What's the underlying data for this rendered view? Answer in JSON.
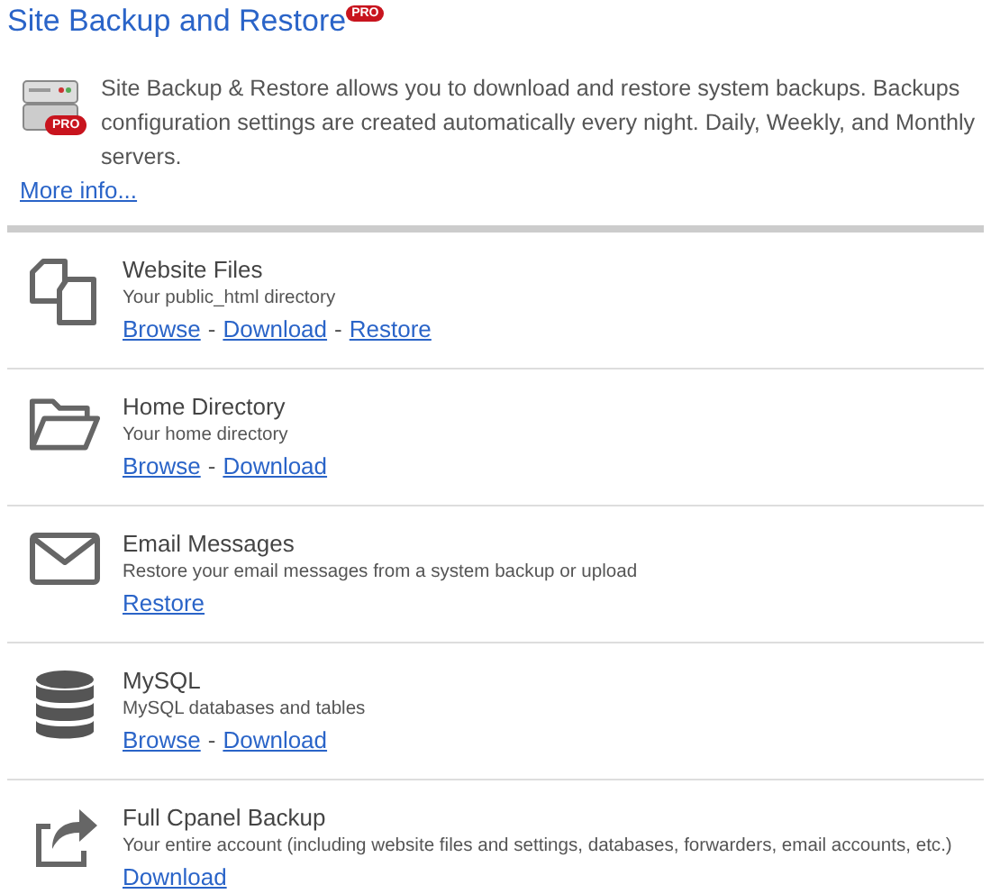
{
  "title": "Site Backup and Restore",
  "title_badge": "PRO",
  "intro": {
    "icon_badge": "PRO",
    "text": "Site Backup & Restore allows you to download and restore system backups. Backups\nconfiguration settings are created automatically every night. Daily, Weekly, and Monthly\nservers.",
    "link": "More info..."
  },
  "items": [
    {
      "kind": "files",
      "title": "Website Files",
      "description": "Your public_html directory",
      "links": [
        {
          "kind": "link",
          "text": "Browse"
        },
        {
          "kind": "separator",
          "text": "-"
        },
        {
          "kind": "link",
          "text": "Download"
        },
        {
          "kind": "separator",
          "text": "-"
        },
        {
          "kind": "link",
          "text": "Restore"
        }
      ]
    },
    {
      "kind": "folder",
      "title": "Home Directory",
      "description": "Your home directory",
      "links": [
        {
          "kind": "link",
          "text": "Browse"
        },
        {
          "kind": "separator",
          "text": "-"
        },
        {
          "kind": "link",
          "text": "Download"
        }
      ]
    },
    {
      "kind": "mail",
      "title": "Email Messages",
      "description": "Restore your email messages from a system backup or upload",
      "links": [
        {
          "kind": "link",
          "text": "Restore"
        }
      ]
    },
    {
      "kind": "database",
      "title": "MySQL",
      "description": "MySQL databases and tables",
      "links": [
        {
          "kind": "link",
          "text": "Browse"
        },
        {
          "kind": "separator",
          "text": "-"
        },
        {
          "kind": "link",
          "text": "Download"
        }
      ]
    },
    {
      "kind": "share",
      "title": "Full Cpanel Backup",
      "description": "Your entire account (including website files and settings, databases, forwarders, email accounts, etc.)",
      "links": [
        {
          "kind": "link",
          "text": "Download"
        }
      ]
    }
  ]
}
